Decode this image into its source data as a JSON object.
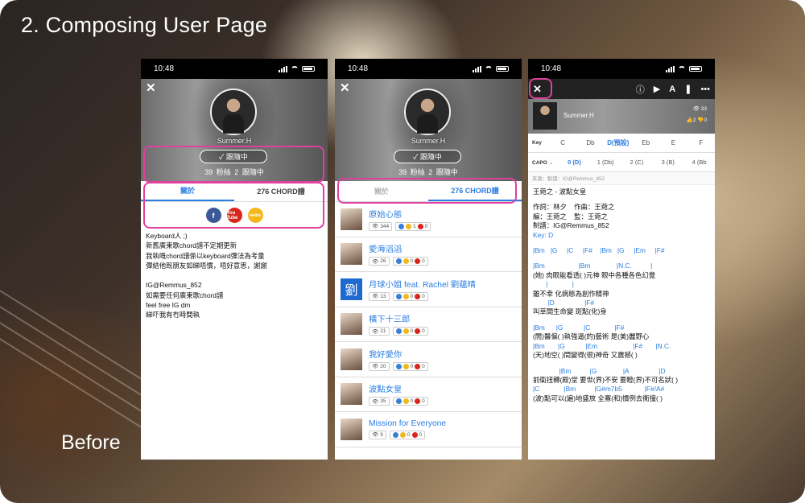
{
  "slide": {
    "title": "2. Composing User Page",
    "caption": "Before"
  },
  "phones": [
    {
      "time": "10:48",
      "close": "✕",
      "profile": {
        "username": "Summer.H",
        "follow_label": "✓ 跟隨中",
        "stats": "39 粉絲   2 跟隨中"
      },
      "tabs": [
        "關於",
        "276 CHORD譜"
      ],
      "social": [
        "f",
        "You Tube",
        "weibo"
      ],
      "bio": [
        "Keyboard人 ;)",
        "新舊廣東歌chord譜不定期更新",
        "我執嘅chord譜係以keyboard彈法為考量",
        "彈結他既朋友如睇唔慣，唔好意思，謝謝",
        "",
        "IG@Remmus_852",
        "如需要任何廣東歌chord譜",
        "feel free IG dm",
        "睇吓我有冇時間執"
      ]
    },
    {
      "time": "10:48",
      "close": "✕",
      "profile": {
        "username": "Summer.H",
        "follow_label": "✓ 跟隨中",
        "stats": "39 粉絲   2 跟隨中"
      },
      "tabs": [
        "關於",
        "276 CHORD譜"
      ],
      "songs": [
        {
          "title": "原始心態",
          "views": "344",
          "likes": "1",
          "dislikes": "0",
          "avatar": ""
        },
        {
          "title": "愛海滔滔",
          "views": "26",
          "likes": "0",
          "dislikes": "0",
          "avatar": ""
        },
        {
          "title": "月球小姐 feat. Rachel 劉蘊晴",
          "views": "13",
          "likes": "0",
          "dislikes": "0",
          "avatar": "劉"
        },
        {
          "title": "橫下十三郎",
          "views": "21",
          "likes": "0",
          "dislikes": "0",
          "avatar": ""
        },
        {
          "title": "我好愛你",
          "views": "20",
          "likes": "0",
          "dislikes": "0",
          "avatar": ""
        },
        {
          "title": "波點女皇",
          "views": "35",
          "likes": "0",
          "dislikes": "0",
          "avatar": ""
        },
        {
          "title": "Mission for Everyone",
          "views": "9",
          "likes": "0",
          "dislikes": "0",
          "avatar": ""
        }
      ]
    },
    {
      "time": "10:48",
      "close": "✕",
      "artist": "Summer.H",
      "mini_stats": {
        "views": "33",
        "likes": "2",
        "dislikes": "0"
      },
      "key_label": "Key",
      "keys": [
        "C",
        "Db",
        "D(預設)",
        "Eb",
        "E",
        "F"
      ],
      "capo_label": "CAPO",
      "capos": [
        "0 (D)",
        "1 (Db)",
        "2 (C)",
        "3 (B)",
        "4 (Bb"
      ],
      "source": "來源：製譜：IG@Remmus_852",
      "sheet": [
        {
          "t": "王菀之 - 波點女皇",
          "c": false
        },
        {
          "t": "",
          "c": false
        },
        {
          "t": "作詞：林夕    作曲：王菀之",
          "c": false
        },
        {
          "t": "編：王菀之    監：王菀之",
          "c": false
        },
        {
          "t": "制譜：IG@Remmus_852",
          "c": false
        },
        {
          "t": "Key: D",
          "c": true
        },
        {
          "t": "",
          "c": false
        },
        {
          "t": "|Bm   |G     |C     |F#    |Bm   |G     |Em     |F#",
          "c": true
        },
        {
          "t": "",
          "c": false
        },
        {
          "t": "|Bm                  |Bm              |N.C.          |",
          "c": true
        },
        {
          "t": "(她) 肉眼能看透( )元神 眼中各種各色幻覺",
          "c": false
        },
        {
          "t": "       |             |",
          "c": true
        },
        {
          "t": "雖不幸 化病態為創作精神",
          "c": false
        },
        {
          "t": "        |D                |F#",
          "c": true
        },
        {
          "t": "叫草間生命變 斑點(化)身",
          "c": false
        },
        {
          "t": "",
          "c": false
        },
        {
          "t": "|Bm      |G           |C             |F#",
          "c": true
        },
        {
          "t": "(閒)醫偏( )執強逼(的)藝術 是(美)麗野心",
          "c": false
        },
        {
          "t": "|Bm       |G           |Em                   |F#       |N.C.",
          "c": true
        },
        {
          "t": "(天)地空( )間變得(很)神奇 又震撼( )",
          "c": false
        },
        {
          "t": "",
          "c": false
        },
        {
          "t": "              |Bm          |G              |A                |D",
          "c": true
        },
        {
          "t": "前衛扭轉(殿)堂 要世(界)不安 要瞪(界)不可名狀( )",
          "c": false
        },
        {
          "t": "|C             |Bm          |G#m7b5            |F#/A#",
          "c": true
        },
        {
          "t": "(波)點可以(遍)地盛放 全寡(和)慣例去衝撞( )",
          "c": false
        }
      ]
    }
  ]
}
